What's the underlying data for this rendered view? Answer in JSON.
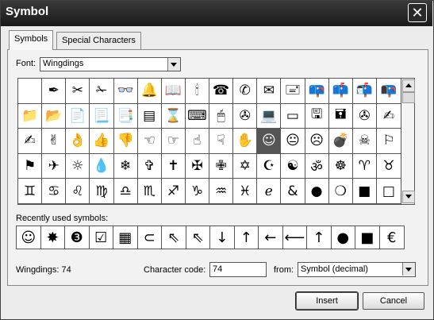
{
  "window": {
    "title": "Symbol",
    "close_label": "✕"
  },
  "tabs": [
    {
      "label": "Symbols"
    },
    {
      "label": "Special Characters"
    }
  ],
  "font": {
    "label": "Font:",
    "value": "Wingdings"
  },
  "symbols": [
    "",
    "✒",
    "✂",
    "✁",
    "👓",
    "🔔",
    "📖",
    "🕯",
    "☎",
    "✆",
    "✉",
    "🖃",
    "📪",
    "📫",
    "📬",
    "📭",
    "📁",
    "📂",
    "📄",
    "📃",
    "📑",
    "▤",
    "⌛",
    "⌨",
    "🖱",
    "✇",
    "💻",
    "▭",
    "🖫",
    "🖬",
    "✇",
    "✍",
    "✍",
    "✌",
    "👌",
    "👍",
    "👎",
    "☜",
    "☞",
    "☝",
    "☟",
    "✋",
    "☺",
    "😐",
    "☹",
    "💣",
    "☠",
    "⚐",
    "⚑",
    "✈",
    "☼",
    "💧",
    "❄",
    "✞",
    "✝",
    "✠",
    "✙",
    "✡",
    "☪",
    "☯",
    "ॐ",
    "☸",
    "♈",
    "♉",
    "♊",
    "♋",
    "♌",
    "♍",
    "♎",
    "♏",
    "♐",
    "♑",
    "♒",
    "♓",
    "ℯ",
    "&",
    "●",
    "❍",
    "■",
    "□"
  ],
  "selected_index": 42,
  "recent": {
    "label": "Recently used symbols:",
    "symbols": [
      "☺",
      "✸",
      "❸",
      "☑",
      "▦",
      "⊂",
      "⇖",
      "⇖",
      "↓",
      "↑",
      "←",
      "⟵",
      "↑",
      "●",
      "■",
      "€"
    ]
  },
  "status_text": "Wingdings: 74",
  "character_code": {
    "label": "Character code:",
    "value": "74"
  },
  "from": {
    "label": "from:",
    "value": "Symbol (decimal)"
  },
  "buttons": {
    "insert": "Insert",
    "cancel": "Cancel"
  }
}
